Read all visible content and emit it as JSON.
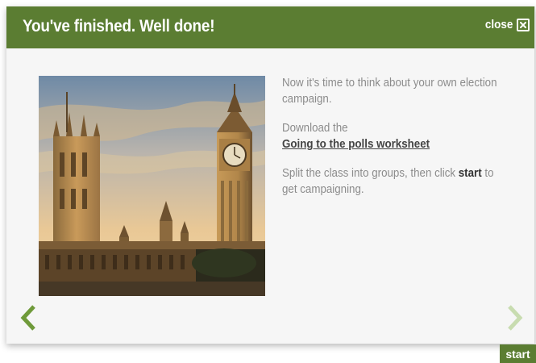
{
  "header": {
    "title": "You've finished. Well done!",
    "close_label": "close",
    "close_icon": "X"
  },
  "content": {
    "para1": "Now it's time to think about your own election campaign.",
    "para2_prefix": "Download the",
    "worksheet_link": "Going to the polls worksheet",
    "para3_before": "Split the class into groups, then click",
    "para3_start": "start",
    "para3_after": "to get campaigning."
  },
  "image": {
    "subject": "Houses of Parliament and Big Ben at sunset"
  },
  "nav": {
    "prev_icon": "chevron-left-icon",
    "next_icon": "chevron-right-icon"
  },
  "start_label": "start",
  "colors": {
    "brand_green": "#5b7d32",
    "arrow_green": "#6f9a3a",
    "arrow_disabled": "#c8dcb0",
    "body_text": "#8c8c8c"
  }
}
